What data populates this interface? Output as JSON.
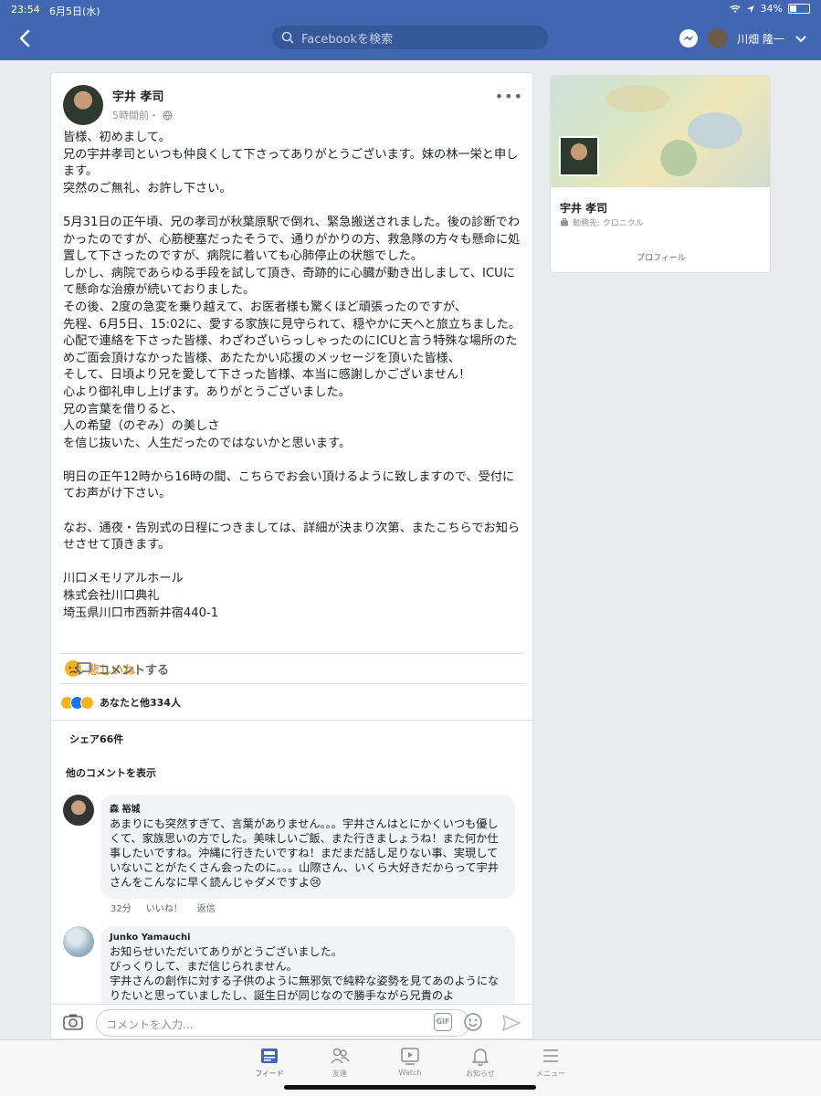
{
  "status": {
    "time": "23:54",
    "date": "6月5日(水)",
    "battery": "34%"
  },
  "header": {
    "search_placeholder": "Facebookを検索",
    "user_name": "川畑 隆一"
  },
  "post": {
    "author": "宇井 孝司",
    "time": "5時間前・",
    "body": "皆様、初めまして。\n兄の宇井孝司といつも仲良くして下さってありがとうございます。妹の林一栄と申します。\n突然のご無礼、お許し下さい。\n\n5月31日の正午頃、兄の孝司が秋葉原駅で倒れ、緊急搬送されました。後の診断でわかったのですが、心筋梗塞だったそうで、通りがかりの方、救急隊の方々も懸命に処置して下さったのですが、病院に着いても心肺停止の状態でした。\nしかし、病院であらゆる手段を試して頂き、奇跡的に心臓が動き出しまして、ICUにて懸命な治療が続いておりました。\nその後、2度の急変を乗り越えて、お医者様も驚くほど頑張ったのですが、\n先程、6月5日、15:02に、愛する家族に見守られて、穏やかに天へと旅立ちました。\n心配で連絡を下さった皆様、わざわざいらっしゃったのにICUと言う特殊な場所のためご面会頂けなかった皆様、あたたかい応援のメッセージを頂いた皆様、\nそして、日頃より兄を愛して下さった皆様、本当に感謝しかございません！\n心より御礼申し上げます。ありがとうございました。\n兄の言葉を借りると、\n人の希望（のぞみ）の美しさ\nを信じ抜いた、人生だったのではないかと思います。\n\n明日の正午12時から16時の間、こちらでお会い頂けるように致しますので、受付にてお声がけ下さい。\n\nなお、通夜・告別式の日程につきましては、詳細が決まり次第、またこちらでお知らせさせて頂きます。\n\n川口メモリアルホール\n株式会社川口典礼\n埼玉県川口市西新井宿440-1",
    "sad_label": "悲しいね",
    "comment_label": "コメントする",
    "reactions_text": "あなたと他334人",
    "shares": "シェア66件",
    "more_comments": "他のコメントを表示"
  },
  "comments": [
    {
      "name": "森 裕城",
      "text": "あまりにも突然すぎて、言葉がありません。。。宇井さんはとにかくいつも優しくて、家族思いの方でした。美味しいご飯、また行きましょうね！また何か仕事したいですね。沖縄に行きたいですね！まだまだ話し足りない事、実現していないことがたくさん会ったのに。。。山際さん、いくら大好きだからって宇井さんをこんなに早く読んじゃダメですよ😢",
      "time": "32分",
      "like": "いいね！",
      "reply": "返信"
    },
    {
      "name": "Junko Yamauchi",
      "text": "お知らせいただいてありがとうございました。\nびっくりして、まだ信じられません。\n宇井さんの創作に対する子供のように無邪気で純粋な姿勢を見てあのようになりたいと思っていましたし、誕生日が同じなので勝手ながら兄貴のよ"
    }
  ],
  "composer": {
    "placeholder": "コメントを入力...",
    "gif": "GIF"
  },
  "profile_card": {
    "name": "宇井 孝司",
    "work": "勤務先: クロニクル",
    "profile_link": "プロフィール"
  },
  "tabs": [
    {
      "label": "フィード",
      "icon": "feed-icon"
    },
    {
      "label": "友達",
      "icon": "friends-icon"
    },
    {
      "label": "Watch",
      "icon": "watch-icon"
    },
    {
      "label": "お知らせ",
      "icon": "bell-icon"
    },
    {
      "label": "メニュー",
      "icon": "menu-icon"
    }
  ],
  "colors": {
    "brand": "#4267b2",
    "sad": "#e3a02b"
  }
}
